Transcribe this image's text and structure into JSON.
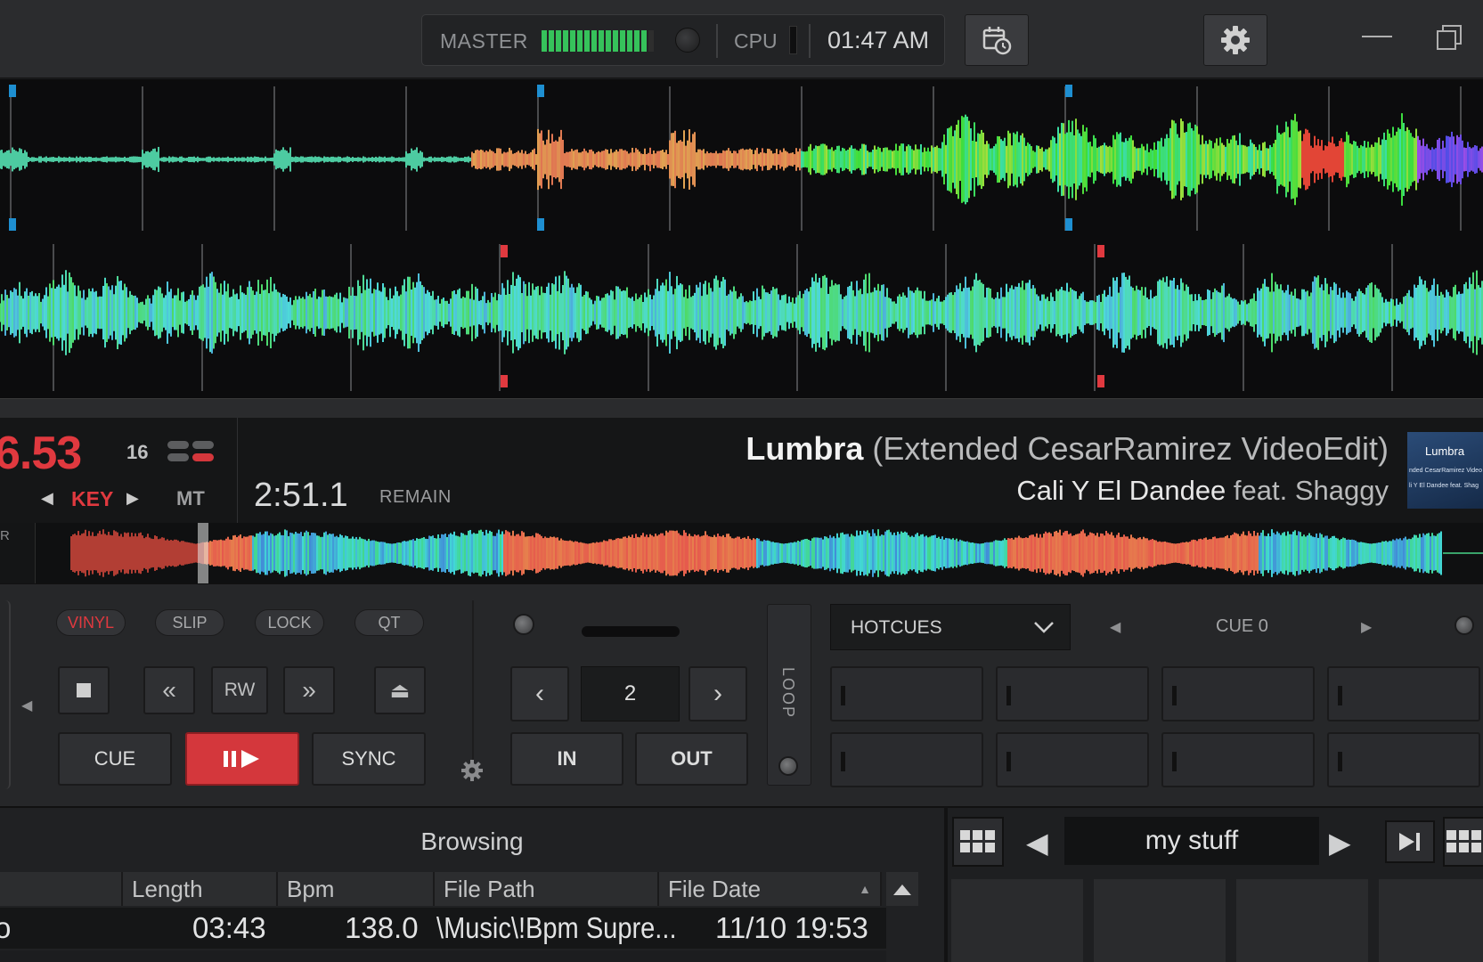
{
  "topbar": {
    "master_label": "MASTER",
    "cpu_label": "CPU",
    "clock": "01:47 AM",
    "icons": [
      "calendar-clock-icon",
      "gear-icon",
      "minimize-icon",
      "restore-icon"
    ]
  },
  "deck": {
    "bpm": "6.53",
    "pitch_range": "16",
    "key_label": "KEY",
    "mt_label": "MT",
    "time": "2:51.1",
    "time_mode": "REMAIN",
    "title": "Lumbra",
    "title_suffix": "(Extended CesarRamirez VideoEdit)",
    "artist": "Cali Y El Dandee",
    "artist_feat": "feat. Shaggy",
    "cover_title": "Lumbra",
    "cover_sub": "nded CesarRamirez Video",
    "cover_sub2": "li Y El Dandee feat. Shag",
    "overview_left": "R"
  },
  "controls": {
    "modes": [
      "VINYL",
      "SLIP",
      "LOCK",
      "QT"
    ],
    "rw_label": "RW",
    "cue_label": "CUE",
    "sync_label": "SYNC",
    "loop_size": "2",
    "in_label": "IN",
    "out_label": "OUT",
    "loop_label": "LOOP",
    "pads_mode": "HOTCUES",
    "cue_name": "CUE 0"
  },
  "browser": {
    "title": "Browsing",
    "columns": [
      "Length",
      "Bpm",
      "File Path",
      "File Date"
    ],
    "rows": [
      {
        "prefix": "o",
        "length": "03:43",
        "bpm": "138.0",
        "path": "\\Music\\!Bpm Supre...",
        "date": "11/10 19:53"
      }
    ]
  },
  "sampler": {
    "name": "my stuff"
  },
  "colors": {
    "accent_red": "#e0393f",
    "vu_green": "#36c25b",
    "cue_marker_blue": "#1e8fd1",
    "cue_marker_red": "#e0393f"
  }
}
